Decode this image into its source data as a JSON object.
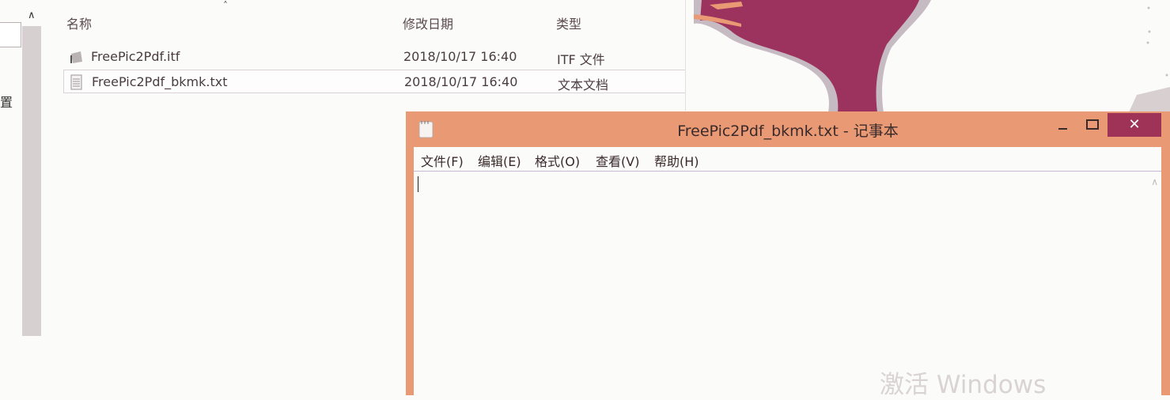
{
  "explorer": {
    "nav_label": "置",
    "columns": {
      "name": "名称",
      "date": "修改日期",
      "type": "类型"
    },
    "files": [
      {
        "name": "FreePic2Pdf.itf",
        "date": "2018/10/17 16:40",
        "type": "ITF 文件",
        "icon": "itf-file-icon"
      },
      {
        "name": "FreePic2Pdf_bkmk.txt",
        "date": "2018/10/17 16:40",
        "type": "文本文档",
        "icon": "text-file-icon"
      }
    ]
  },
  "notepad": {
    "title": "FreePic2Pdf_bkmk.txt - 记事本",
    "menu": [
      "文件(F)",
      "编辑(E)",
      "格式(O)",
      "查看(V)",
      "帮助(H)"
    ],
    "content": "",
    "close_glyph": "✕",
    "colors": {
      "frame": "#e99a75",
      "close_button": "#9e3357"
    }
  },
  "watermark": "激活 Windows"
}
